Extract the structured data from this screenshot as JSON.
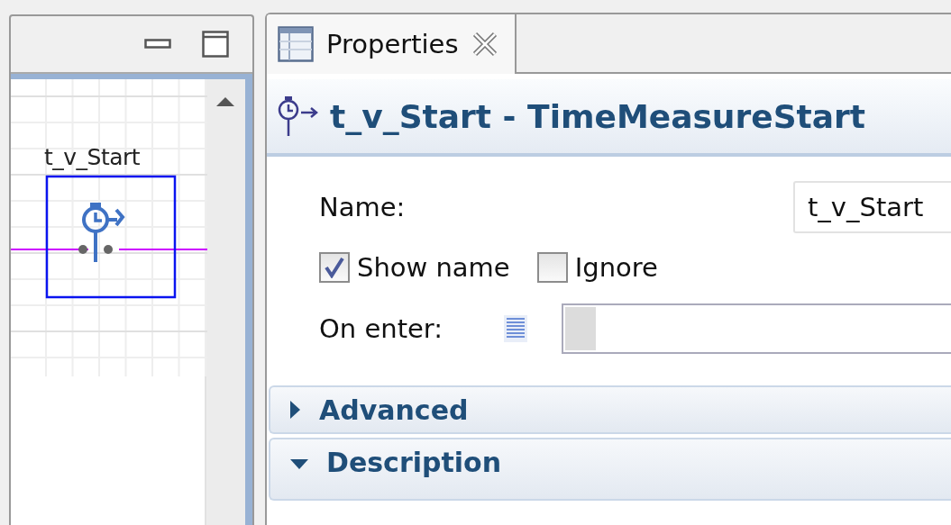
{
  "diagram_panel": {
    "block": {
      "label": "t_v_Start"
    }
  },
  "properties_panel": {
    "tab": {
      "label": "Properties",
      "selected": true
    },
    "title": "t_v_Start - TimeMeasureStart",
    "name_field": {
      "label": "Name:",
      "value": "t_v_Start"
    },
    "checkboxes": [
      {
        "label": "Show name",
        "checked": true
      },
      {
        "label": "Ignore",
        "checked": false
      }
    ],
    "on_enter": {
      "label": "On enter:"
    },
    "sections": [
      {
        "label": "Advanced",
        "expanded": false
      },
      {
        "label": "Description",
        "expanded": true
      }
    ]
  }
}
